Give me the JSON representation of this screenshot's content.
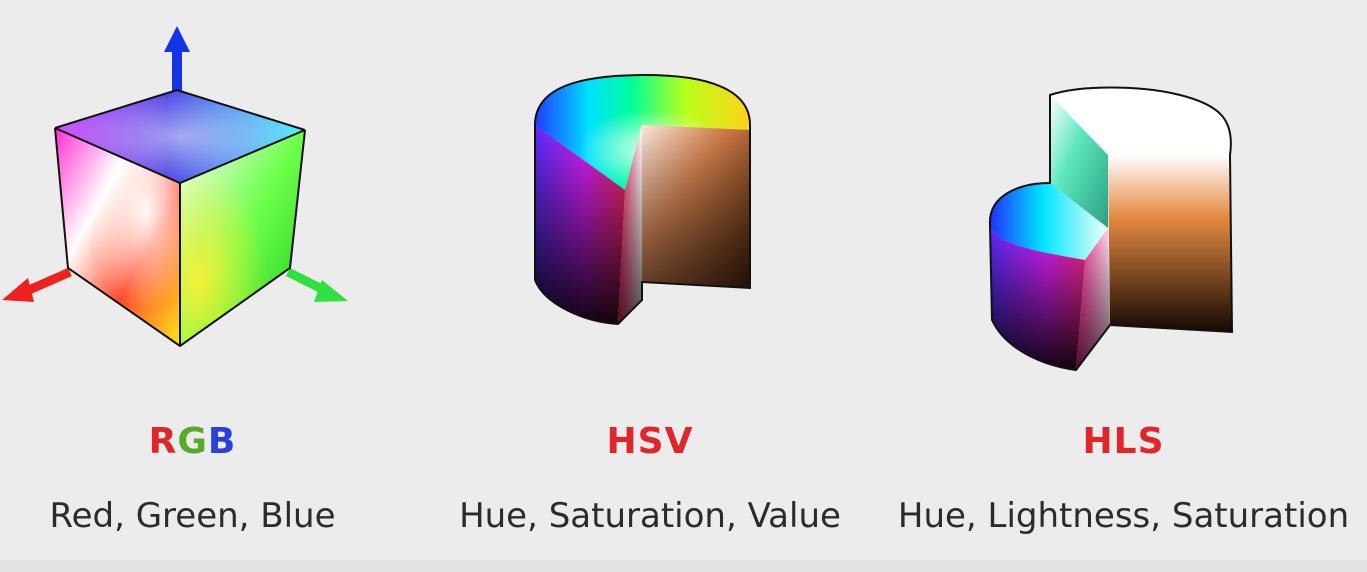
{
  "colors": {
    "background": "#ececec",
    "accent_red": "#e0262b",
    "accent_green": "#5aa82e",
    "accent_blue": "#2a3fdc",
    "text": "#2b2b2b"
  },
  "models": [
    {
      "id": "rgb",
      "icon": "rgb-cube-icon",
      "acronym_letters": [
        {
          "char": "R",
          "color": "#e0262b"
        },
        {
          "char": "G",
          "color": "#5aa82e"
        },
        {
          "char": "B",
          "color": "#2a3fdc"
        }
      ],
      "description": "Red, Green, Blue"
    },
    {
      "id": "hsv",
      "icon": "hsv-cylinder-icon",
      "acronym": "HSV",
      "acronym_color": "#e0262b",
      "description": "Hue, Saturation, Value"
    },
    {
      "id": "hls",
      "icon": "hls-double-cylinder-icon",
      "acronym": "HLS",
      "acronym_color": "#e0262b",
      "description": "Hue, Lightness, Saturation"
    }
  ]
}
